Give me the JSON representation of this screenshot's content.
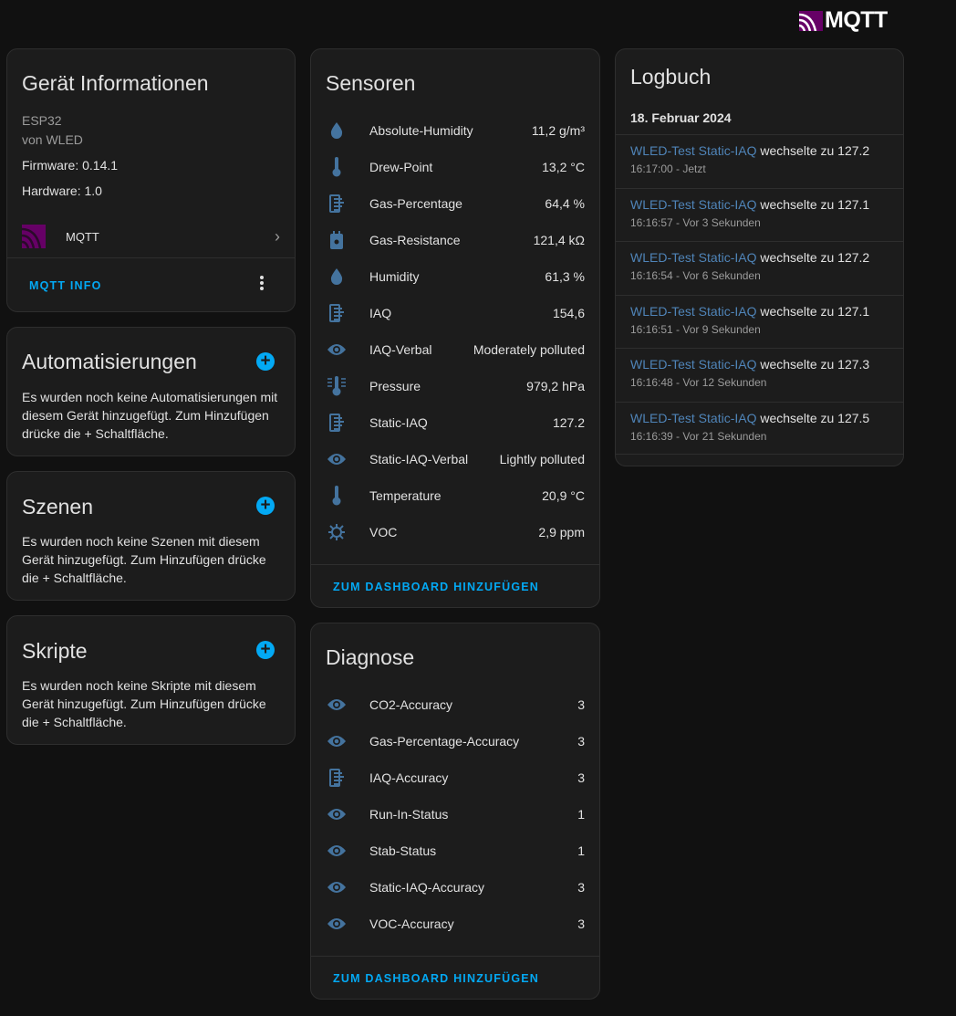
{
  "header": {
    "logo_text": "MQTT"
  },
  "device_info": {
    "title": "Gerät Informationen",
    "model": "ESP32",
    "manufacturer": "von WLED",
    "firmware": "Firmware: 0.14.1",
    "hardware": "Hardware: 1.0",
    "integration": "MQTT",
    "action": "MQTT INFO"
  },
  "automations": {
    "title": "Automatisierungen",
    "text": "Es wurden noch keine Automatisierungen mit diesem Gerät hinzugefügt. Zum Hinzufügen drücke die + Schaltfläche."
  },
  "scenes": {
    "title": "Szenen",
    "text": "Es wurden noch keine Szenen mit diesem Gerät hinzugefügt. Zum Hinzufügen drücke die + Schaltfläche."
  },
  "scripts": {
    "title": "Skripte",
    "text": "Es wurden noch keine Skripte mit diesem Gerät hinzugefügt. Zum Hinzufügen drücke die + Schaltfläche."
  },
  "sensors": {
    "title": "Sensoren",
    "add_label": "ZUM DASHBOARD HINZUFÜGEN",
    "items": [
      {
        "name": "Absolute-Humidity",
        "value": "11,2 g/m³",
        "icon": "water-percent-icon"
      },
      {
        "name": "Drew-Point",
        "value": "13,2 °C",
        "icon": "thermometer-icon"
      },
      {
        "name": "Gas-Percentage",
        "value": "64,4 %",
        "icon": "air-filter-icon"
      },
      {
        "name": "Gas-Resistance",
        "value": "121,4 kΩ",
        "icon": "meter-icon"
      },
      {
        "name": "Humidity",
        "value": "61,3 %",
        "icon": "water-percent-icon"
      },
      {
        "name": "IAQ",
        "value": "154,6",
        "icon": "air-filter-icon"
      },
      {
        "name": "IAQ-Verbal",
        "value": "Moderately polluted",
        "icon": "eye-icon"
      },
      {
        "name": "Pressure",
        "value": "979,2 hPa",
        "icon": "thermometer-lines-icon"
      },
      {
        "name": "Static-IAQ",
        "value": "127.2",
        "icon": "air-filter-icon"
      },
      {
        "name": "Static-IAQ-Verbal",
        "value": "Lightly polluted",
        "icon": "eye-icon"
      },
      {
        "name": "Temperature",
        "value": "20,9 °C",
        "icon": "thermometer-icon"
      },
      {
        "name": "VOC",
        "value": "2,9 ppm",
        "icon": "virus-icon"
      }
    ]
  },
  "diagnostics": {
    "title": "Diagnose",
    "add_label": "ZUM DASHBOARD HINZUFÜGEN",
    "items": [
      {
        "name": "CO2-Accuracy",
        "value": "3",
        "icon": "eye-icon"
      },
      {
        "name": "Gas-Percentage-Accuracy",
        "value": "3",
        "icon": "eye-icon"
      },
      {
        "name": "IAQ-Accuracy",
        "value": "3",
        "icon": "air-filter-icon"
      },
      {
        "name": "Run-In-Status",
        "value": "1",
        "icon": "eye-icon"
      },
      {
        "name": "Stab-Status",
        "value": "1",
        "icon": "eye-icon"
      },
      {
        "name": "Static-IAQ-Accuracy",
        "value": "3",
        "icon": "eye-icon"
      },
      {
        "name": "VOC-Accuracy",
        "value": "3",
        "icon": "eye-icon"
      }
    ]
  },
  "logbook": {
    "title": "Logbuch",
    "date": "18. Februar 2024",
    "entries": [
      {
        "entity": "WLED-Test Static-IAQ",
        "message": "wechselte zu 127.2",
        "time": "16:17:00 - Jetzt"
      },
      {
        "entity": "WLED-Test Static-IAQ",
        "message": "wechselte zu 127.1",
        "time": "16:16:57 - Vor 3 Sekunden"
      },
      {
        "entity": "WLED-Test Static-IAQ",
        "message": "wechselte zu 127.2",
        "time": "16:16:54 - Vor 6 Sekunden"
      },
      {
        "entity": "WLED-Test Static-IAQ",
        "message": "wechselte zu 127.1",
        "time": "16:16:51 - Vor 9 Sekunden"
      },
      {
        "entity": "WLED-Test Static-IAQ",
        "message": "wechselte zu 127.3",
        "time": "16:16:48 - Vor 12 Sekunden"
      },
      {
        "entity": "WLED-Test Static-IAQ",
        "message": "wechselte zu 127.5",
        "time": "16:16:39 - Vor 21 Sekunden"
      }
    ]
  },
  "colors": {
    "accent": "#03a9f4",
    "icon": "#44739e",
    "link": "#4f84b8",
    "mqtt_purple": "#660066"
  }
}
